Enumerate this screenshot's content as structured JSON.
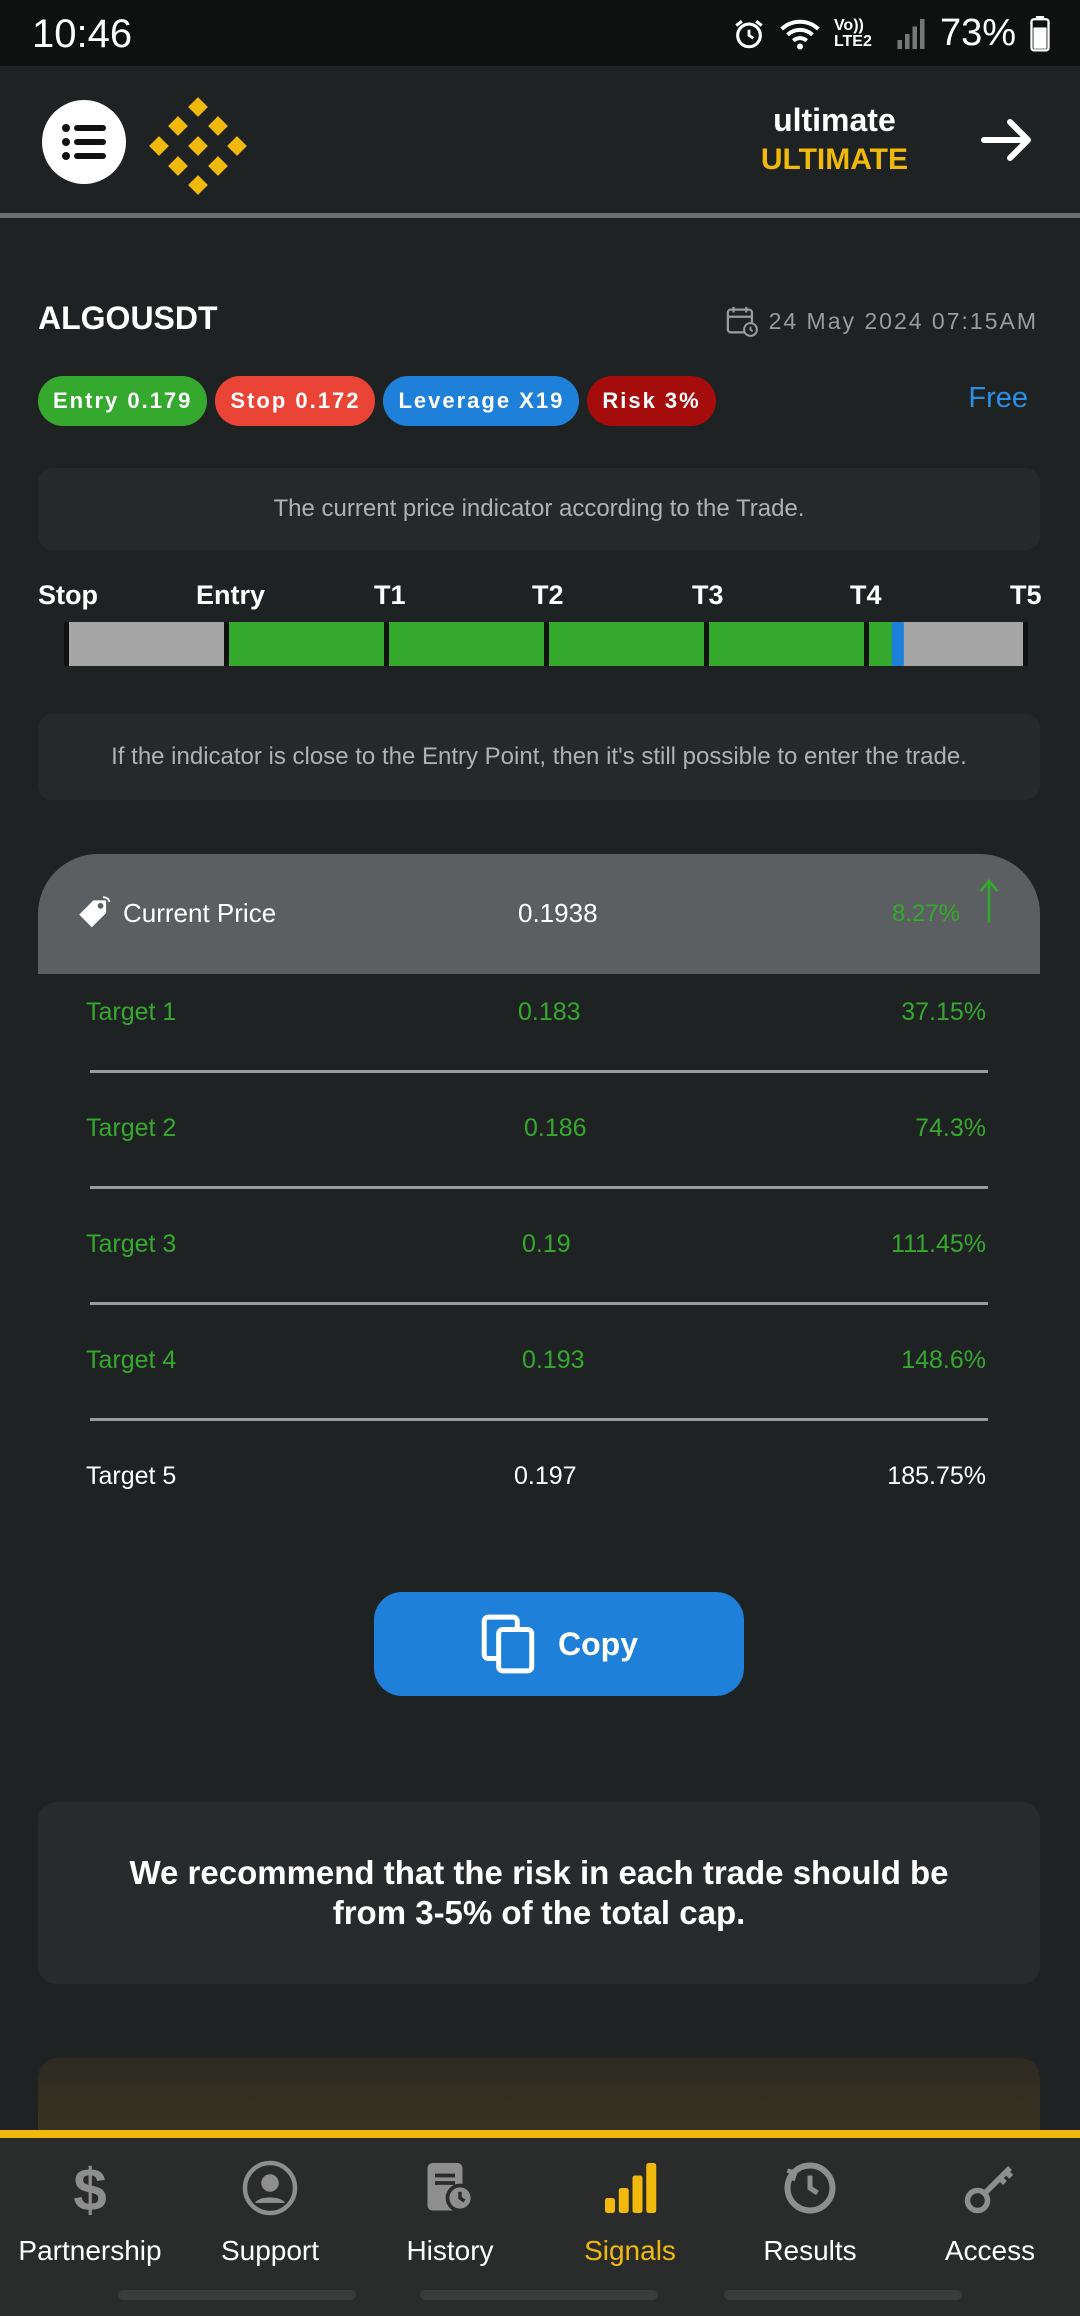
{
  "status_bar": {
    "time": "10:46",
    "network": "Vo)) LTE2",
    "battery": "73%"
  },
  "header": {
    "user_name": "ultimate",
    "user_plan": "ULTIMATE"
  },
  "signal": {
    "symbol": "ALGOUSDT",
    "date": "24 May 2024 07:15AM",
    "entry": "Entry 0.179",
    "stop": "Stop 0.172",
    "leverage": "Leverage X19",
    "risk": "Risk 3%",
    "access": "Free"
  },
  "indicator": {
    "caption": "The current price indicator according to the Trade.",
    "labels": [
      "Stop",
      "Entry",
      "T1",
      "T2",
      "T3",
      "T4",
      "T5"
    ],
    "note": "If the indicator is close to the Entry Point, then it's still possible to enter the trade.",
    "progress_fraction": 0.865
  },
  "current_price": {
    "label": "Current Price",
    "value": "0.1938",
    "change": "8.27%"
  },
  "targets": [
    {
      "label": "Target 1",
      "price": "0.183",
      "percent": "37.15%"
    },
    {
      "label": "Target 2",
      "price": "0.186",
      "percent": "74.3%"
    },
    {
      "label": "Target 3",
      "price": "0.19",
      "percent": "111.45%"
    },
    {
      "label": "Target 4",
      "price": "0.193",
      "percent": "148.6%"
    },
    {
      "label": "Target 5",
      "price": "0.197",
      "percent": "185.75%"
    }
  ],
  "copy_label": "Copy",
  "recommendation": "We recommend that the risk in each trade should be from 3-5% of the total cap.",
  "nav": [
    {
      "label": "Partnership",
      "icon": "dollar-icon"
    },
    {
      "label": "Support",
      "icon": "support-agent-icon"
    },
    {
      "label": "History",
      "icon": "history-icon"
    },
    {
      "label": "Signals",
      "icon": "signal-bars-icon"
    },
    {
      "label": "Results",
      "icon": "results-icon"
    },
    {
      "label": "Access",
      "icon": "key-icon"
    }
  ],
  "colors": {
    "accent": "#f0b90b",
    "green": "#35a82e",
    "red": "#ea4437",
    "blue": "#1f80d9",
    "dark_red": "#a50d0d"
  }
}
